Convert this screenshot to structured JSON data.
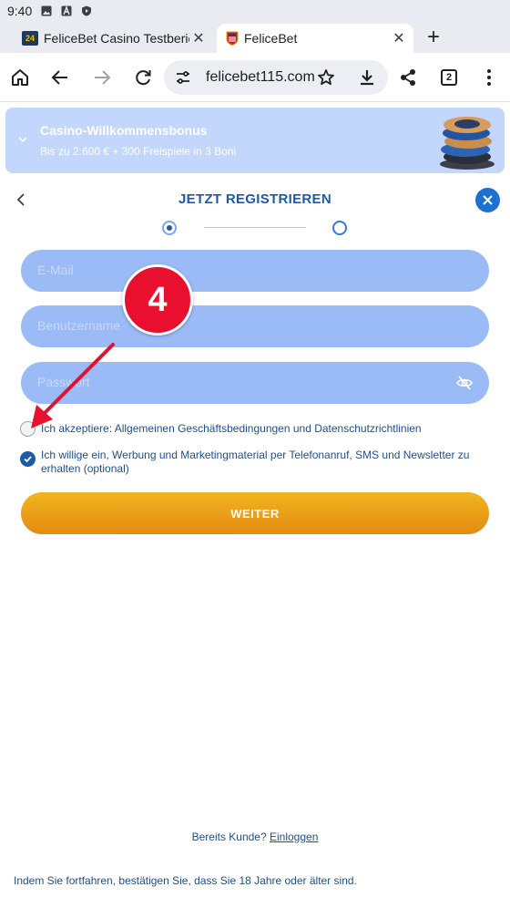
{
  "status_bar": {
    "time": "9:40"
  },
  "browser": {
    "tabs": [
      {
        "title": "FeliceBet Casino Testbericht",
        "favicon_text": "WETTEN 24"
      },
      {
        "title": "FeliceBet"
      }
    ],
    "url": "felicebet115.com",
    "tab_count": "2"
  },
  "bonus_banner": {
    "title": "Casino-Willkommensbonus",
    "subtitle": "Bis zu 2.600 € + 300 Freispiele in 3 Boni"
  },
  "registration": {
    "title": "JETZT REGISTRIEREN",
    "fields": {
      "email_placeholder": "E-Mail",
      "username_placeholder": "Benutzername",
      "password_placeholder": "Passwort"
    },
    "terms_label": "Ich akzeptiere: Allgemeinen Geschäftsbedingungen und Datenschutzrichtlinien",
    "marketing_label": "Ich willige ein, Werbung und Marketingmaterial per Telefonanruf, SMS und Newsletter zu erhalten (optional)",
    "submit_label": "WEITER",
    "existing_customer": "Bereits Kunde?",
    "login_link": "Einloggen",
    "age_notice": "Indem Sie fortfahren, bestätigen Sie, dass Sie 18 Jahre oder älter sind."
  },
  "annotation": {
    "step_number": "4"
  },
  "colors": {
    "primary_blue": "#1f5aa6",
    "field_blue": "#9bbbf6",
    "banner_blue": "#c3d6fb",
    "cta_orange": "#e9a117",
    "annotation_red": "#e8102e"
  }
}
